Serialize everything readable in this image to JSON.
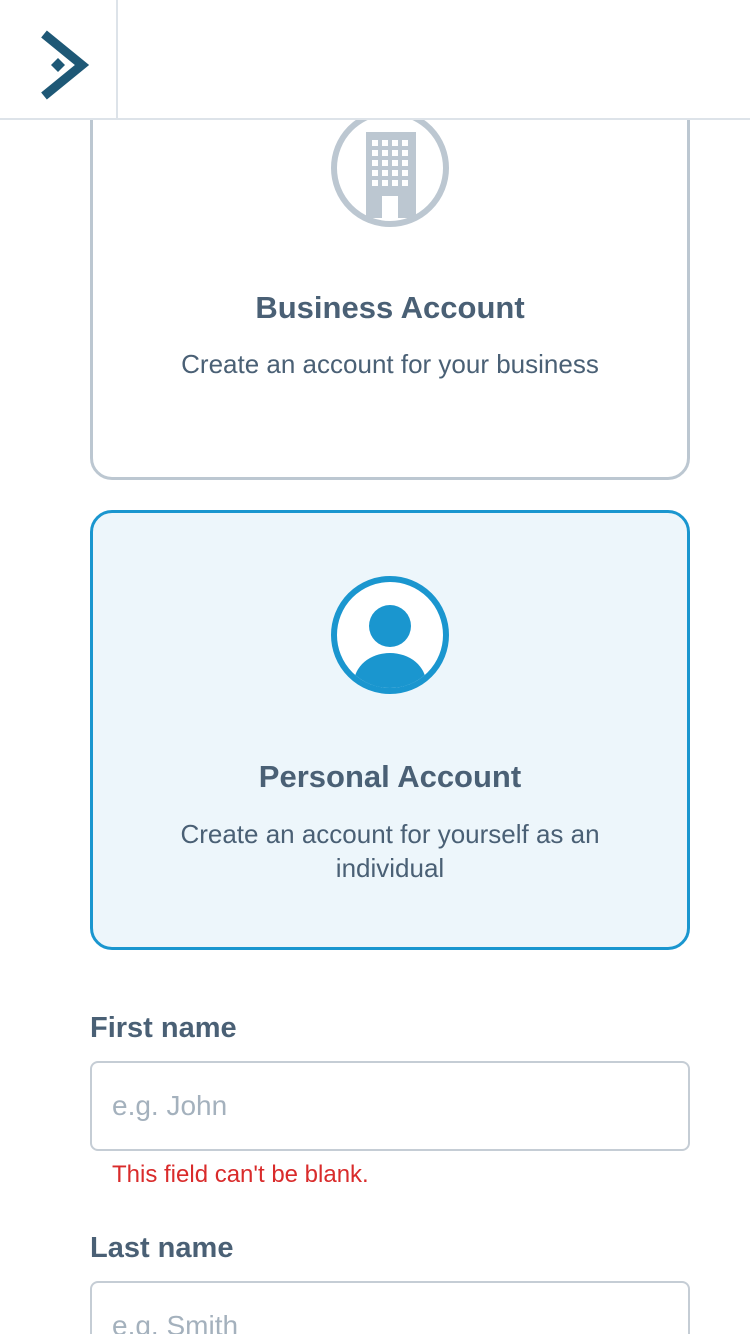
{
  "header": {
    "logo_icon": "chevron-diamond-logo-icon"
  },
  "account_types": {
    "business": {
      "icon": "building-icon",
      "title": "Business Account",
      "description": "Create an account for your business"
    },
    "personal": {
      "icon": "user-circle-icon",
      "title": "Personal Account",
      "description": "Create an account for yourself as an individual",
      "selected": true
    }
  },
  "form": {
    "first_name": {
      "label": "First name",
      "placeholder": "e.g. John",
      "value": "",
      "error": "This field can't be blank."
    },
    "last_name": {
      "label": "Last name",
      "placeholder": "e.g. Smith",
      "value": ""
    }
  },
  "colors": {
    "accent": "#1a96cf",
    "selected_bg": "#edf6fb",
    "text": "#4a6075",
    "muted_border": "#bcc7d1",
    "error": "#d92b2b",
    "logo": "#1e5876"
  }
}
